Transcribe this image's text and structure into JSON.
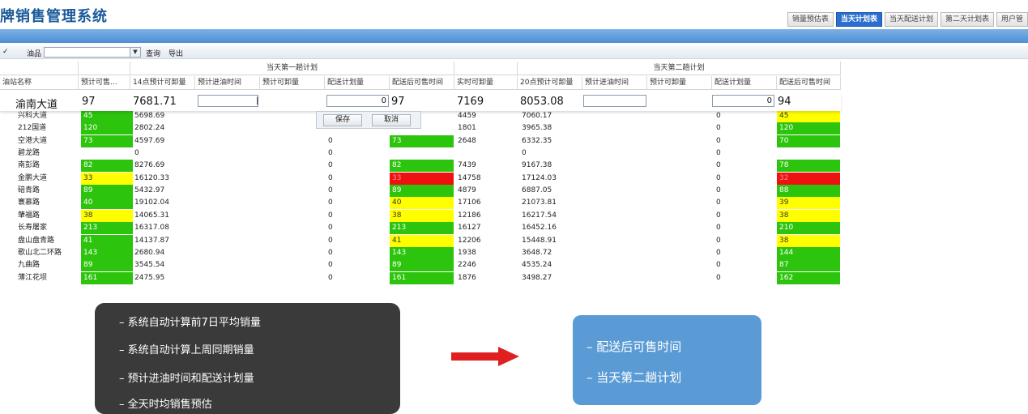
{
  "header": {
    "title": "牌销售管理系统",
    "tabs": [
      {
        "label": "销量预估表",
        "active": false
      },
      {
        "label": "当天计划表",
        "active": true
      },
      {
        "label": "当天配送计划",
        "active": false
      },
      {
        "label": "第二天计划表",
        "active": false
      },
      {
        "label": "用户管"
      }
    ]
  },
  "toolbar": {
    "oil_label": "油品",
    "oil_value": "",
    "query_label": "查询",
    "export_label": "导出"
  },
  "grid": {
    "group1_label": "当天第一趟计划",
    "group2_label": "当天第二趟计划",
    "columns": [
      "油站名称",
      "预计可售...",
      "14点预计可卸量",
      "预计进油时间",
      "预计可卸量",
      "配送计划量",
      "配送后可售时间",
      "实时可卸量",
      "20点预计可卸量",
      "预计进油时间",
      "预计可卸量",
      "配送计划量",
      "配送后可售时间"
    ],
    "edit_row": {
      "name": "渝南大道",
      "forecast": "97",
      "unload14": "7681.71",
      "entry_time": "",
      "plan_qty": "0",
      "sell_time": "97",
      "realtime": "7169",
      "unload20": "8053.08",
      "entry_time2": "",
      "plan_qty2": "0",
      "sell_time2": "94"
    },
    "popup": {
      "save_label": "保存",
      "cancel_label": "取消"
    },
    "rows": [
      {
        "name": "兴科大道",
        "forecast": "45",
        "fc": "green",
        "unload14": "5698.69",
        "plan": "",
        "sell": "",
        "sc": "",
        "realtime": "4459",
        "unload20": "7060.17",
        "plan2": "0",
        "sell2": "45",
        "sc2": "yellow"
      },
      {
        "name": "212国道",
        "forecast": "120",
        "fc": "green",
        "unload14": "2802.24",
        "plan": "",
        "sell": "",
        "sc": "",
        "realtime": "1801",
        "unload20": "3965.38",
        "plan2": "0",
        "sell2": "120",
        "sc2": "green"
      },
      {
        "name": "空港大道",
        "forecast": "73",
        "fc": "green",
        "unload14": "4597.69",
        "plan": "0",
        "sell": "73",
        "sc": "green",
        "realtime": "2648",
        "unload20": "6332.35",
        "plan2": "0",
        "sell2": "70",
        "sc2": "green"
      },
      {
        "name": "碧龙路",
        "forecast": "",
        "fc": "",
        "unload14": "0",
        "plan": "0",
        "sell": "",
        "sc": "",
        "realtime": "",
        "unload20": "0",
        "plan2": "0",
        "sell2": "",
        "sc2": ""
      },
      {
        "name": "南彭路",
        "forecast": "82",
        "fc": "green",
        "unload14": "8276.69",
        "plan": "0",
        "sell": "82",
        "sc": "green",
        "realtime": "7439",
        "unload20": "9167.38",
        "plan2": "0",
        "sell2": "78",
        "sc2": "green"
      },
      {
        "name": "金鹏大道",
        "forecast": "33",
        "fc": "yellow",
        "unload14": "16120.33",
        "plan": "0",
        "sell": "33",
        "sc": "red",
        "realtime": "14758",
        "unload20": "17124.03",
        "plan2": "0",
        "sell2": "32",
        "sc2": "red"
      },
      {
        "name": "碚青路",
        "forecast": "89",
        "fc": "green",
        "unload14": "5432.97",
        "plan": "0",
        "sell": "89",
        "sc": "green",
        "realtime": "4879",
        "unload20": "6887.05",
        "plan2": "0",
        "sell2": "88",
        "sc2": "green"
      },
      {
        "name": "寰慕路",
        "forecast": "40",
        "fc": "green",
        "unload14": "19102.04",
        "plan": "0",
        "sell": "40",
        "sc": "yellow",
        "realtime": "17106",
        "unload20": "21073.81",
        "plan2": "0",
        "sell2": "39",
        "sc2": "yellow"
      },
      {
        "name": "肇福路",
        "forecast": "38",
        "fc": "yellow",
        "unload14": "14065.31",
        "plan": "0",
        "sell": "38",
        "sc": "yellow",
        "realtime": "12186",
        "unload20": "16217.54",
        "plan2": "0",
        "sell2": "38",
        "sc2": "yellow"
      },
      {
        "name": "长寿屠家",
        "forecast": "213",
        "fc": "green",
        "unload14": "16317.08",
        "plan": "0",
        "sell": "213",
        "sc": "green",
        "realtime": "16127",
        "unload20": "16452.16",
        "plan2": "0",
        "sell2": "210",
        "sc2": "green"
      },
      {
        "name": "盘山盘青路",
        "forecast": "41",
        "fc": "green",
        "unload14": "14137.87",
        "plan": "0",
        "sell": "41",
        "sc": "yellow",
        "realtime": "12206",
        "unload20": "15448.91",
        "plan2": "0",
        "sell2": "38",
        "sc2": "yellow"
      },
      {
        "name": "歌山北二环路",
        "forecast": "143",
        "fc": "green",
        "unload14": "2680.94",
        "plan": "0",
        "sell": "143",
        "sc": "green",
        "realtime": "1938",
        "unload20": "3648.72",
        "plan2": "0",
        "sell2": "144",
        "sc2": "green"
      },
      {
        "name": "九曲路",
        "forecast": "89",
        "fc": "green",
        "unload14": "3545.54",
        "plan": "0",
        "sell": "89",
        "sc": "green",
        "realtime": "2246",
        "unload20": "4535.24",
        "plan2": "0",
        "sell2": "87",
        "sc2": "green"
      },
      {
        "name": "薄江花坝",
        "forecast": "161",
        "fc": "green",
        "unload14": "2475.95",
        "plan": "0",
        "sell": "161",
        "sc": "green",
        "realtime": "1876",
        "unload20": "3498.27",
        "plan2": "0",
        "sell2": "162",
        "sc2": "green"
      }
    ]
  },
  "annotations": {
    "left": [
      "–   系统自动计算前7日平均销量",
      "–   系统自动计算上周同期销量",
      "–   预计进油时间和配送计划量",
      "–   全天时均销售预估"
    ],
    "right": [
      "–   配送后可售时间",
      "–   当天第二趟计划"
    ],
    "colors": {
      "left_bg": "#3a3a3a",
      "right_bg": "#5b9bd5",
      "arrow": "#e02020",
      "green": "#2dc40e",
      "yellow": "#ffff00",
      "red": "#ee1111"
    }
  }
}
